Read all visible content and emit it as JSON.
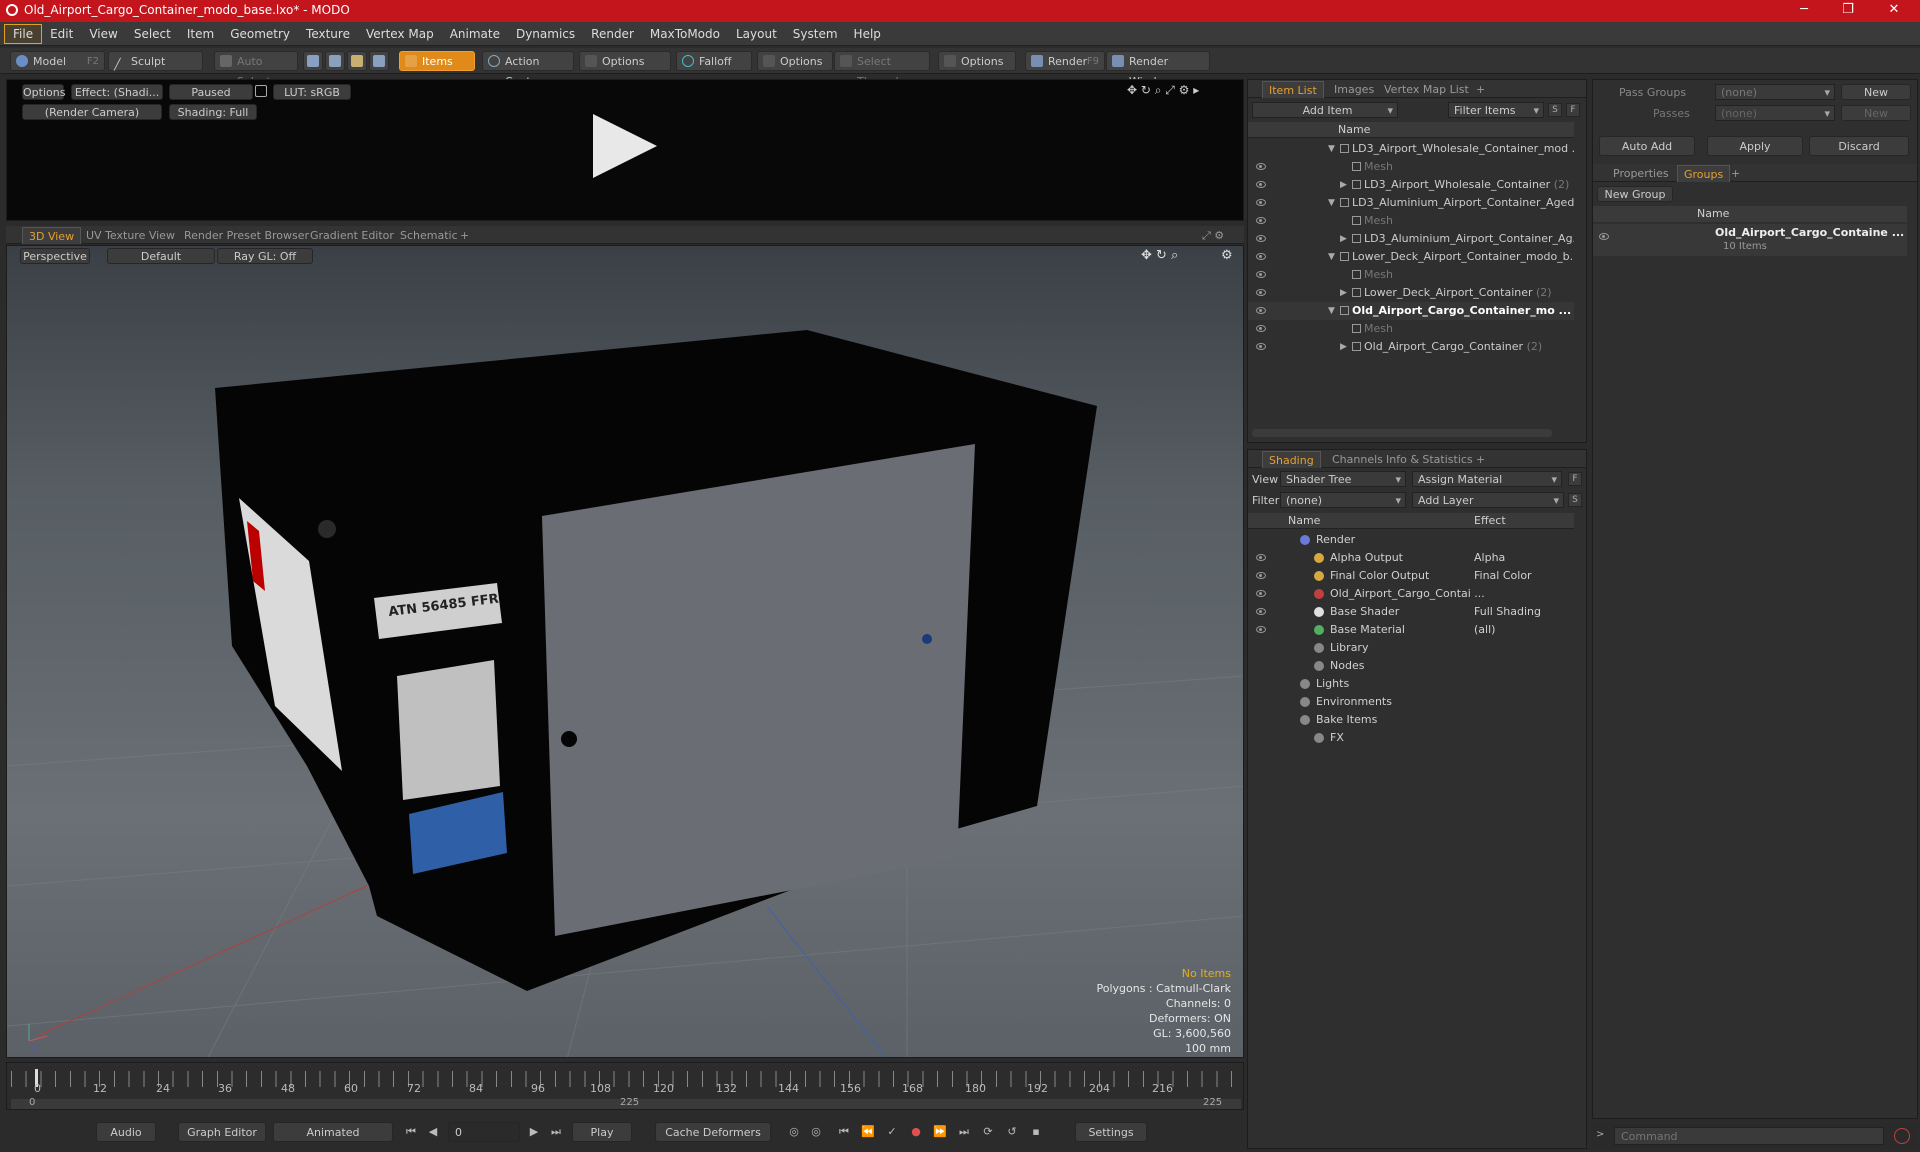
{
  "window": {
    "title": "Old_Airport_Cargo_Container_modo_base.lxo* - MODO",
    "minimize": "─",
    "restore": "❐",
    "close": "✕"
  },
  "menu": [
    "File",
    "Edit",
    "View",
    "Select",
    "Item",
    "Geometry",
    "Texture",
    "Vertex Map",
    "Animate",
    "Dynamics",
    "Render",
    "MaxToModo",
    "Layout",
    "System",
    "Help"
  ],
  "toolbar": {
    "model": "Model",
    "model_key": "F2",
    "sculpt": "Sculpt",
    "auto_select": "Auto Select",
    "items": "Items",
    "action_center": "Action Center",
    "options1": "Options",
    "falloff": "Falloff",
    "options2": "Options",
    "select_through": "Select Through",
    "options3": "Options",
    "render": "Render",
    "render_key": "F9",
    "render_window": "Render Window"
  },
  "preview": {
    "options": "Options",
    "effect": "Effect: (Shadi...",
    "paused": "Paused",
    "lut": "LUT: sRGB",
    "camera": "(Render Camera)",
    "shading": "Shading: Full"
  },
  "viewport_tabs": [
    "3D View",
    "UV Texture View",
    "Render Preset Browser",
    "Gradient Editor",
    "Schematic"
  ],
  "viewport": {
    "perspective": "Perspective",
    "default": "Default",
    "raygl": "Ray GL: Off",
    "stats": [
      "No Items",
      "Polygons : Catmull-Clark",
      "Channels: 0",
      "Deformers: ON",
      "GL: 3,600,560",
      "100 mm"
    ],
    "label_id": "ATN 56485 FFR"
  },
  "timeline": {
    "ticks": [
      "0",
      "12",
      "24",
      "36",
      "48",
      "60",
      "72",
      "84",
      "96",
      "108",
      "120",
      "132",
      "144",
      "156",
      "168",
      "180",
      "192",
      "204",
      "216"
    ],
    "range_start": "0",
    "range_mid": "225",
    "range_end": "225"
  },
  "bottombar": {
    "audio": "Audio",
    "graph_editor": "Graph Editor",
    "animated": "Animated",
    "frame": "0",
    "play": "Play",
    "cache": "Cache Deformers",
    "settings": "Settings"
  },
  "itemlist": {
    "tabs": [
      "Item List",
      "Images",
      "Vertex Map List"
    ],
    "add_item": "Add Item",
    "filter": "Filter Items",
    "s": "S",
    "f": "F",
    "col_name": "Name",
    "rows": [
      {
        "text": "LD3_Airport_Wholesale_Container_mod ...",
        "indent": 0,
        "kind": "scene",
        "bold": false,
        "count": ""
      },
      {
        "text": "Mesh",
        "indent": 1,
        "kind": "mesh",
        "bold": false,
        "count": ""
      },
      {
        "text": "LD3_Airport_Wholesale_Container",
        "indent": 1,
        "kind": "group",
        "bold": false,
        "count": "(2)"
      },
      {
        "text": "LD3_Aluminium_Airport_Container_Aged...",
        "indent": 0,
        "kind": "scene",
        "bold": false,
        "count": ""
      },
      {
        "text": "Mesh",
        "indent": 1,
        "kind": "mesh",
        "bold": false,
        "count": ""
      },
      {
        "text": "LD3_Aluminium_Airport_Container_Ag...",
        "indent": 1,
        "kind": "group",
        "bold": false,
        "count": ""
      },
      {
        "text": "Lower_Deck_Airport_Container_modo_b...",
        "indent": 0,
        "kind": "scene",
        "bold": false,
        "count": ""
      },
      {
        "text": "Mesh",
        "indent": 1,
        "kind": "mesh",
        "bold": false,
        "count": ""
      },
      {
        "text": "Lower_Deck_Airport_Container",
        "indent": 1,
        "kind": "group",
        "bold": false,
        "count": "(2)"
      },
      {
        "text": "Old_Airport_Cargo_Container_mo ...",
        "indent": 0,
        "kind": "scene",
        "bold": true,
        "count": ""
      },
      {
        "text": "Mesh",
        "indent": 1,
        "kind": "mesh",
        "bold": false,
        "count": ""
      },
      {
        "text": "Old_Airport_Cargo_Container",
        "indent": 1,
        "kind": "group",
        "bold": false,
        "count": "(2)"
      }
    ]
  },
  "shading": {
    "tabs": [
      "Shading",
      "Channels",
      "Info & Statistics"
    ],
    "view_label": "View",
    "view_value": "Shader Tree",
    "assign": "Assign Material",
    "filter_label": "Filter",
    "filter_value": "(none)",
    "add_layer": "Add Layer",
    "f": "F",
    "s": "S",
    "col_name": "Name",
    "col_effect": "Effect",
    "rows": [
      {
        "name": "Render",
        "effect": "",
        "indent": 0,
        "eye": false
      },
      {
        "name": "Alpha Output",
        "effect": "Alpha",
        "indent": 1,
        "eye": true
      },
      {
        "name": "Final Color Output",
        "effect": "Final Color",
        "indent": 1,
        "eye": true
      },
      {
        "name": "Old_Airport_Cargo_Contai ...",
        "effect": "",
        "indent": 1,
        "eye": true
      },
      {
        "name": "Base Shader",
        "effect": "Full Shading",
        "indent": 1,
        "eye": true
      },
      {
        "name": "Base Material",
        "effect": "(all)",
        "indent": 1,
        "eye": true
      },
      {
        "name": "Library",
        "effect": "",
        "indent": 1,
        "eye": false
      },
      {
        "name": "Nodes",
        "effect": "",
        "indent": 1,
        "eye": false
      },
      {
        "name": "Lights",
        "effect": "",
        "indent": 0,
        "eye": false
      },
      {
        "name": "Environments",
        "effect": "",
        "indent": 0,
        "eye": false
      },
      {
        "name": "Bake Items",
        "effect": "",
        "indent": 0,
        "eye": false
      },
      {
        "name": "FX",
        "effect": "",
        "indent": 1,
        "eye": false
      }
    ]
  },
  "groups": {
    "pass_groups": "Pass Groups",
    "passes": "Passes",
    "none1": "(none)",
    "none2": "(none)",
    "new": "New",
    "new2": "New",
    "auto_add": "Auto Add",
    "apply": "Apply",
    "discard": "Discard",
    "tabs": [
      "Properties",
      "Groups"
    ],
    "new_group": "New Group",
    "col_name": "Name",
    "group_name": "Old_Airport_Cargo_Containe ...",
    "group_items": "10 Items"
  },
  "command": {
    "placeholder": "Command"
  }
}
